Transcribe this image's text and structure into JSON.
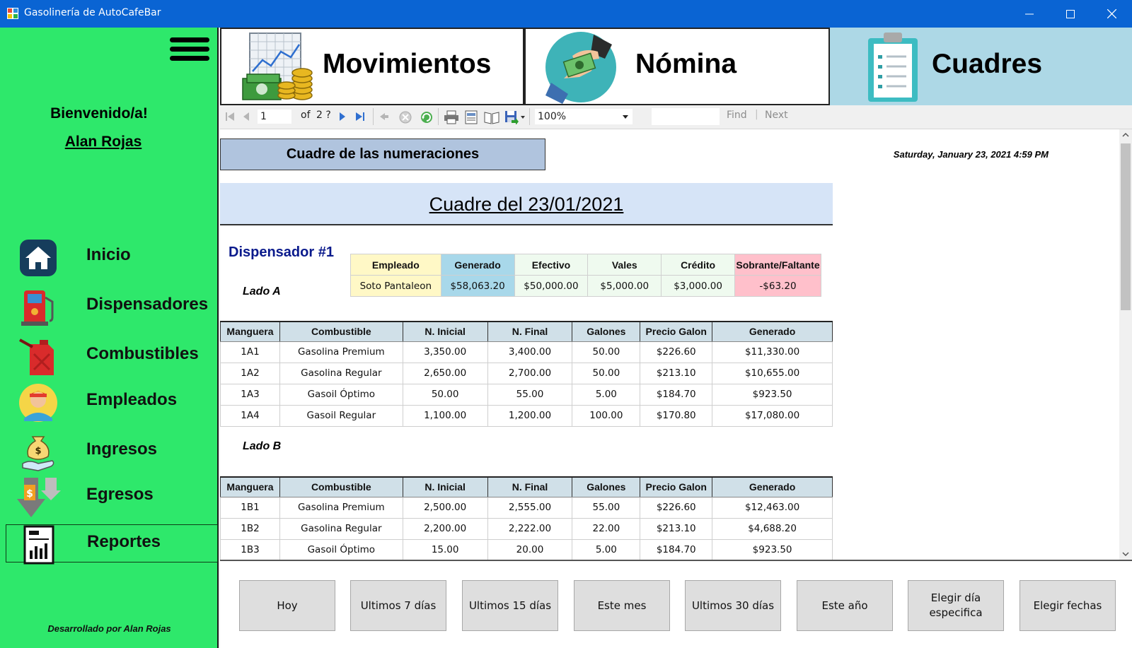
{
  "window": {
    "title": "Gasolinería de AutoCafeBar"
  },
  "sidebar": {
    "welcome": "Bienvenido/a!",
    "user": "Alan Rojas",
    "items": [
      {
        "label": "Inicio",
        "icon": "home-icon"
      },
      {
        "label": "Dispensadores",
        "icon": "fuel-pump-icon"
      },
      {
        "label": "Combustibles",
        "icon": "fuel-can-icon"
      },
      {
        "label": "Empleados",
        "icon": "employee-icon"
      },
      {
        "label": "Ingresos",
        "icon": "income-icon"
      },
      {
        "label": "Egresos",
        "icon": "expenses-icon"
      },
      {
        "label": "Reportes",
        "icon": "report-icon"
      }
    ],
    "credit": "Desarrollado por Alan Rojas"
  },
  "tabs": [
    {
      "label": "Movimientos",
      "icon": "chart-money-icon"
    },
    {
      "label": "Nómina",
      "icon": "payroll-icon"
    },
    {
      "label": "Cuadres",
      "icon": "clipboard-icon"
    }
  ],
  "toolbar": {
    "page": "1",
    "of": "of",
    "total": "2 ?",
    "zoom": "100%",
    "find": "Find",
    "next": "Next",
    "separator": "|"
  },
  "report": {
    "title": "Cuadre de las numeraciones",
    "date": "Saturday, January 23, 2021 4:59 PM",
    "banner": "Cuadre del 23/01/2021",
    "dispenser": "Dispensador #1",
    "summary": {
      "headers": [
        "Empleado",
        "Generado",
        "Efectivo",
        "Vales",
        "Crédito",
        "Sobrante/Faltante"
      ],
      "row": [
        "Soto Pantaleon",
        "$58,063.20",
        "$50,000.00",
        "$5,000.00",
        "$3,000.00",
        "-$63.20"
      ]
    },
    "grid_headers": [
      "Manguera",
      "Combustible",
      "N. Inicial",
      "N. Final",
      "Galones",
      "Precio Galon",
      "Generado"
    ],
    "lado_a": {
      "label": "Lado A",
      "rows": [
        [
          "1A1",
          "Gasolina Premium",
          "3,350.00",
          "3,400.00",
          "50.00",
          "$226.60",
          "$11,330.00"
        ],
        [
          "1A2",
          "Gasolina Regular",
          "2,650.00",
          "2,700.00",
          "50.00",
          "$213.10",
          "$10,655.00"
        ],
        [
          "1A3",
          "Gasoil Óptimo",
          "50.00",
          "55.00",
          "5.00",
          "$184.70",
          "$923.50"
        ],
        [
          "1A4",
          "Gasoil Regular",
          "1,100.00",
          "1,200.00",
          "100.00",
          "$170.80",
          "$17,080.00"
        ]
      ]
    },
    "lado_b": {
      "label": "Lado B",
      "rows": [
        [
          "1B1",
          "Gasolina Premium",
          "2,500.00",
          "2,555.00",
          "55.00",
          "$226.60",
          "$12,463.00"
        ],
        [
          "1B2",
          "Gasolina Regular",
          "2,200.00",
          "2,222.00",
          "22.00",
          "$213.10",
          "$4,688.20"
        ],
        [
          "1B3",
          "Gasoil Óptimo",
          "15.00",
          "20.00",
          "5.00",
          "$184.70",
          "$923.50"
        ]
      ]
    }
  },
  "filters": [
    {
      "label": "Hoy"
    },
    {
      "label": "Ultimos 7 días"
    },
    {
      "label": "Ultimos 15 días"
    },
    {
      "label": "Este mes"
    },
    {
      "label": "Ultimos 30 días"
    },
    {
      "label": "Este año"
    },
    {
      "label": "Elegir día\nespecifica"
    },
    {
      "label": "Elegir fechas"
    }
  ],
  "colors": {
    "titlebar": "#0a64d3",
    "sidebar": "#2ee86b",
    "tab_selected": "#add8e6",
    "report_title_bg": "#b0c4de",
    "banner_bg": "#d6e4f7",
    "col_empleado": "#fff8c6",
    "col_generado": "#a8d8ea",
    "col_money": "#effaef",
    "col_sobrante": "#ffc0cb",
    "grid_header": "#d0e0e8",
    "dispenser_title": "#0a1a8c"
  }
}
